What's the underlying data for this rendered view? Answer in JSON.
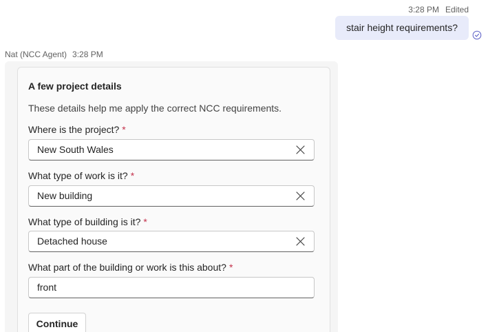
{
  "sent_message": {
    "time": "3:28 PM",
    "status": "Edited",
    "text": "stair height requirements?",
    "receipt_icon": "read-receipt-check-icon"
  },
  "received_message": {
    "sender": "Nat (NCC Agent)",
    "time": "3:28 PM"
  },
  "card": {
    "title": "A few project details",
    "subtitle": "These details help me apply the correct NCC requirements.",
    "required_marker": "*",
    "fields": [
      {
        "label": "Where is the project?",
        "value": "New South Wales",
        "clearable": true
      },
      {
        "label": "What type of work is it?",
        "value": "New building",
        "clearable": true
      },
      {
        "label": "What type of building is it?",
        "value": "Detached house",
        "clearable": true
      },
      {
        "label": "What part of the building or work is this about?",
        "value": "front",
        "clearable": false
      }
    ],
    "continue_label": "Continue"
  },
  "colors": {
    "sent_bubble": "#e8ebfa",
    "received_bubble": "#f5f5f5",
    "required_asterisk": "#c4314b",
    "accent": "#5b5fc7"
  }
}
